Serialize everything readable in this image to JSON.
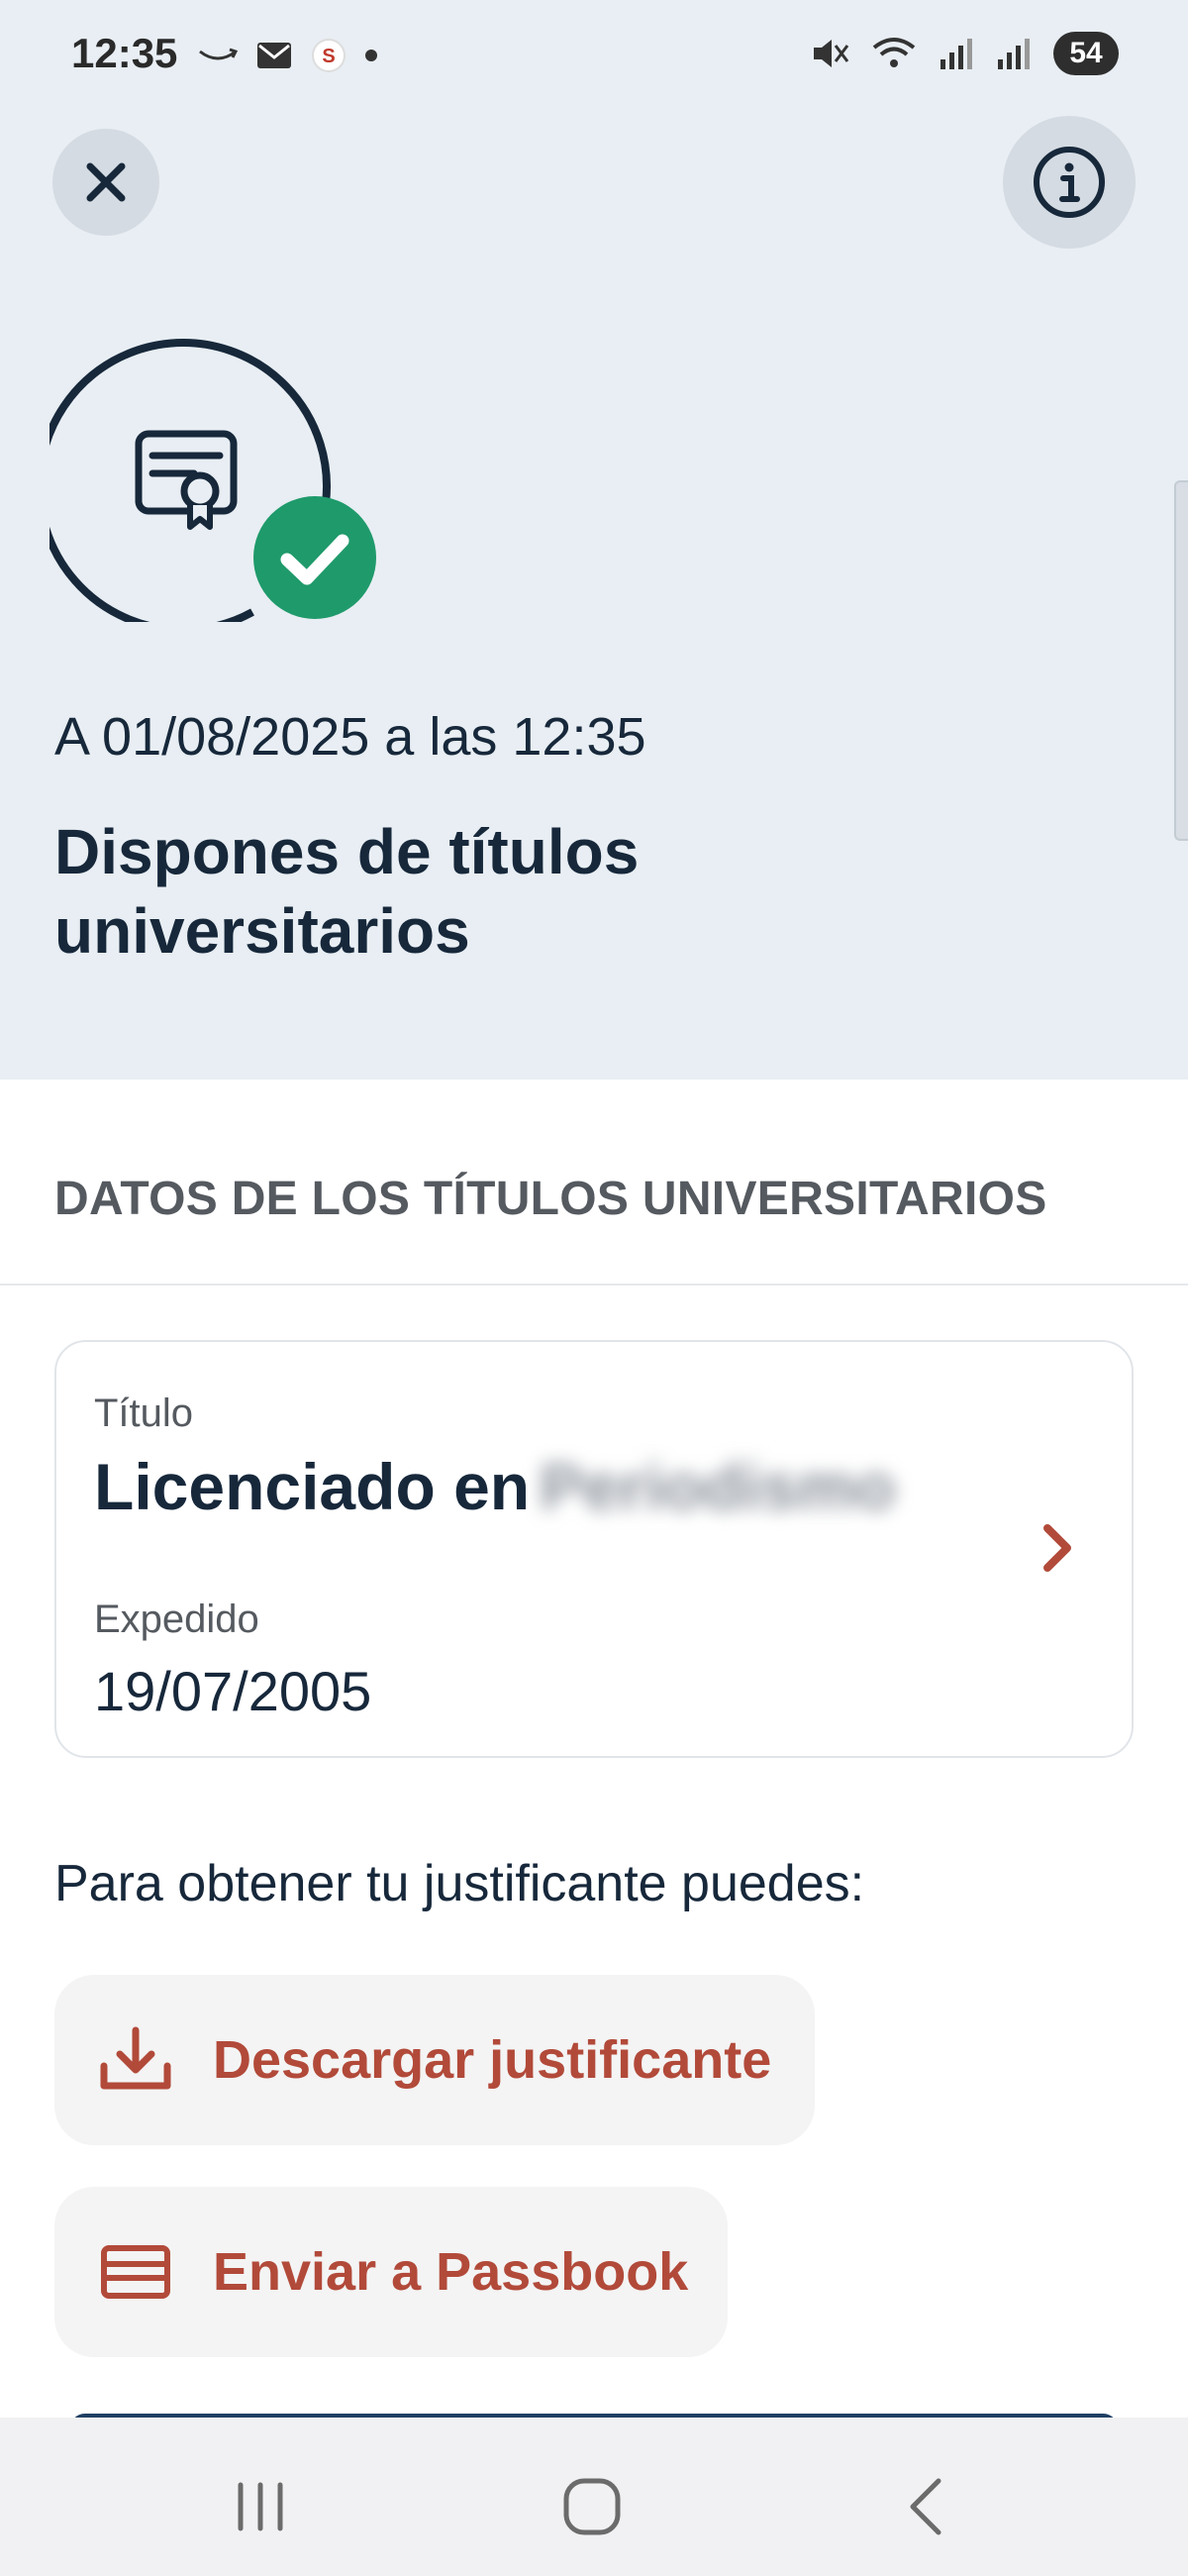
{
  "status_bar": {
    "time": "12:35",
    "battery": "54",
    "left_icons": [
      "amazon-icon",
      "mail-icon",
      "app-s-icon",
      "dot-icon"
    ],
    "right_icons": [
      "mute-icon",
      "wifi-icon",
      "signal-icon",
      "signal-icon"
    ]
  },
  "header": {
    "close_icon": "close-icon",
    "info_icon": "info-icon",
    "hero_icon": "certificate-check-icon",
    "date_line": "A 01/08/2025 a las 12:35",
    "headline": "Dispones de títulos universitarios"
  },
  "section": {
    "title": "DATOS DE LOS TÍTULOS UNIVERSITARIOS"
  },
  "title_card": {
    "label_title": "Título",
    "title_value": "Licenciado en",
    "title_value_blurred": "Periodismo",
    "label_issued": "Expedido",
    "issued_date": "19/07/2005"
  },
  "actions": {
    "instructions": "Para obtener tu justificante puedes:",
    "download_label": "Descargar justificante",
    "passbook_label": "Enviar a Passbook"
  },
  "colors": {
    "header_bg": "#e8eef3",
    "navy": "#17283b",
    "accent_red": "#b24a3a",
    "check_green": "#1f9a6b"
  }
}
